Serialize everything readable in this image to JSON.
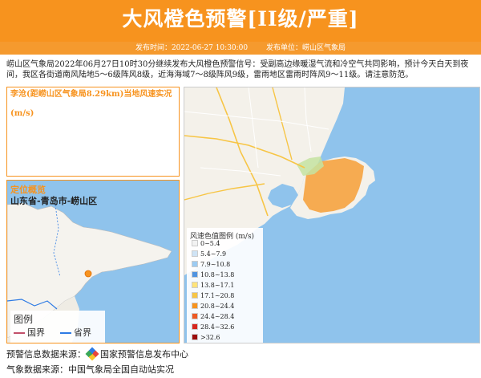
{
  "header": {
    "title": "大风橙色预警[II级/严重]",
    "publish_time": "发布时间：2022-06-27 10:30:00",
    "publisher": "发布单位：崂山区气象局"
  },
  "description": "崂山区气象局2022年06月27日10时30分继续发布大风橙色预警信号：受副高边缘暖湿气流和冷空气共同影响，预计今天白天到夜间，我区各街道南风陆地5～6级阵风8级，近海海域7～8级阵风9级，雷雨地区雷雨时阵风9～11级。请注意防范。",
  "wind_panel": {
    "title": "李沧(距崂山区气象局8.29km)当地风速实况",
    "unit": "(m/s)"
  },
  "location_panel": {
    "title": "定位概览",
    "location": "山东省-青岛市-崂山区",
    "legend_title": "图例",
    "legend_national": "国界",
    "legend_provincial": "省界"
  },
  "wind_legend": {
    "title": "风速色值图例 (m/s)",
    "items": [
      {
        "label": "0~5.4",
        "color": "#f2f2f2"
      },
      {
        "label": "5.4~7.9",
        "color": "#cfe3f5"
      },
      {
        "label": "7.9~10.8",
        "color": "#9ccbf2"
      },
      {
        "label": "10.8~13.8",
        "color": "#4f93e0"
      },
      {
        "label": "13.8~17.1",
        "color": "#ffe37a"
      },
      {
        "label": "17.1~20.8",
        "color": "#f7c545"
      },
      {
        "label": "20.8~24.4",
        "color": "#f7931e"
      },
      {
        "label": "24.4~28.4",
        "color": "#ee5a24"
      },
      {
        "label": "28.4~32.6",
        "color": "#d7261e"
      },
      {
        "label": ">32.6",
        "color": "#9c0d0d"
      }
    ]
  },
  "sources": {
    "warning_source": "预警信息数据来源：",
    "warning_source_name": "国家预警信息发布中心",
    "weather_source": "气象数据来源：中国气象局全国自动站实况"
  }
}
